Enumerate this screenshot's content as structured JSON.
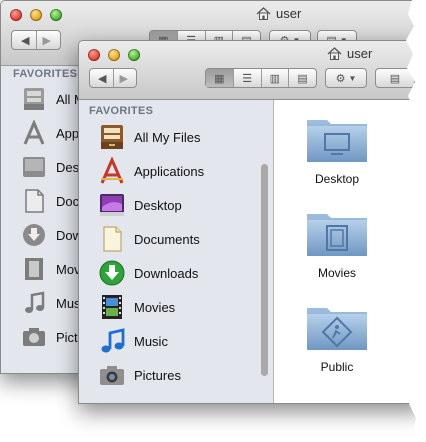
{
  "back_window": {
    "title": "user",
    "title_icon": "home-icon",
    "favorites_heading": "FAVORITES",
    "sidebar_items": [
      {
        "label": "All My Files",
        "icon": "all-my-files-icon"
      },
      {
        "label": "Applications",
        "icon": "applications-icon"
      },
      {
        "label": "Desktop",
        "icon": "desktop-icon"
      },
      {
        "label": "Documents",
        "icon": "documents-icon"
      },
      {
        "label": "Downloads",
        "icon": "downloads-icon"
      },
      {
        "label": "Movies",
        "icon": "movies-icon"
      },
      {
        "label": "Music",
        "icon": "music-icon"
      },
      {
        "label": "Pictures",
        "icon": "pictures-icon"
      }
    ]
  },
  "front_window": {
    "title": "user",
    "favorites_heading": "FAVORITES",
    "toolbar": {
      "back_icon": "back-arrow-icon",
      "forward_icon": "forward-arrow-icon",
      "view_modes": [
        "icon-view",
        "list-view",
        "column-view",
        "coverflow-view"
      ],
      "active_view": "icon-view",
      "action_icon": "gear-icon"
    },
    "sidebar_items": [
      {
        "label": "All My Files",
        "icon": "all-my-files-icon"
      },
      {
        "label": "Applications",
        "icon": "applications-icon"
      },
      {
        "label": "Desktop",
        "icon": "desktop-icon"
      },
      {
        "label": "Documents",
        "icon": "documents-icon"
      },
      {
        "label": "Downloads",
        "icon": "downloads-icon"
      },
      {
        "label": "Movies",
        "icon": "movies-icon"
      },
      {
        "label": "Music",
        "icon": "music-icon"
      },
      {
        "label": "Pictures",
        "icon": "pictures-icon"
      }
    ],
    "folders": [
      {
        "name": "Desktop",
        "icon": "desktop-folder-icon"
      },
      {
        "name": "Movies",
        "icon": "movies-folder-icon"
      },
      {
        "name": "Public",
        "icon": "public-folder-icon"
      }
    ]
  },
  "colors": {
    "sidebar_bg": "#e3e7ed",
    "folder_blue": "#8fb2d6",
    "toolbar_bg": "#d6d6d6"
  }
}
